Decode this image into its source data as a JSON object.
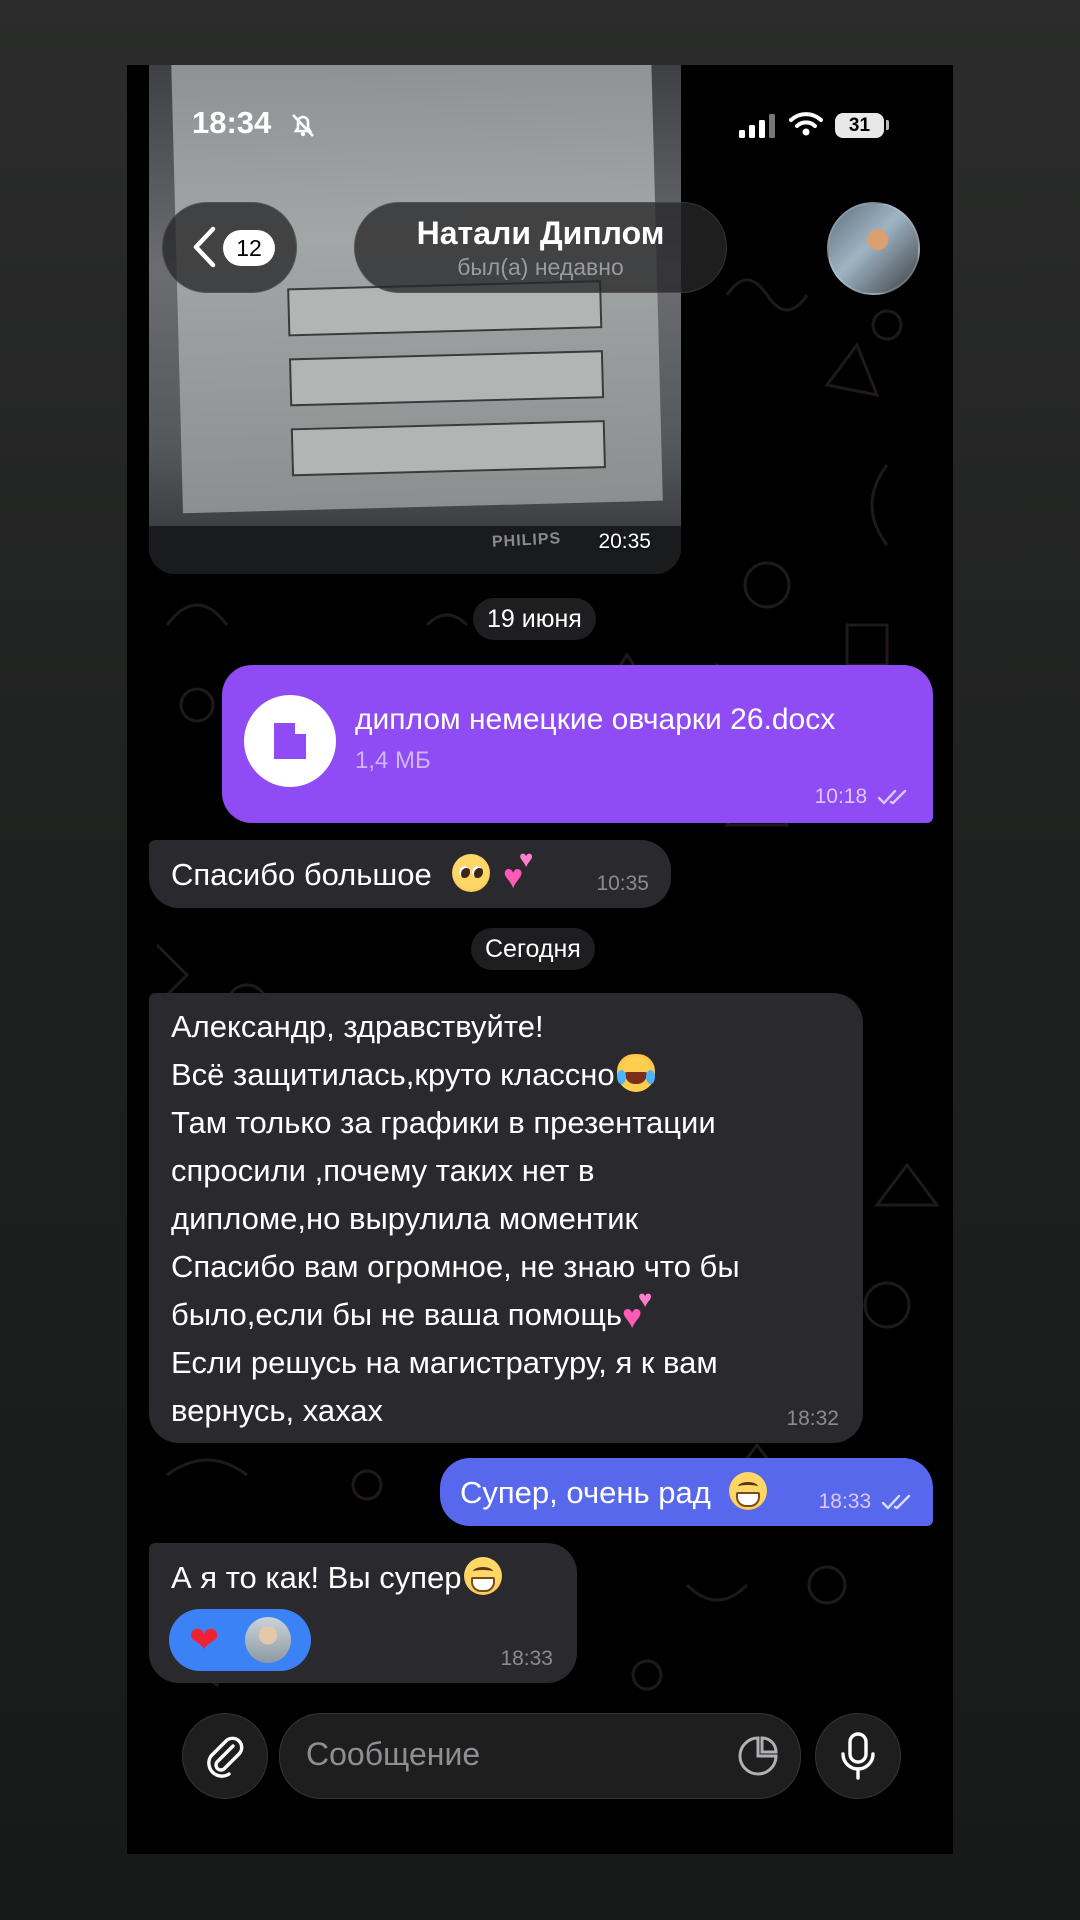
{
  "status_bar": {
    "time": "18:34",
    "battery": "31"
  },
  "header": {
    "back_count": "12",
    "title": "Натали Диплом",
    "subtitle": "был(а) недавно"
  },
  "photo_message": {
    "time": "20:35",
    "brand": "PHILIPS"
  },
  "dates": {
    "first": "19 июня",
    "second": "Сегодня"
  },
  "messages": {
    "file": {
      "name": "диплом немецкие овчарки 26.docx",
      "size": "1,4 МБ",
      "time": "10:18"
    },
    "thanks": {
      "text": "Спасибо большое",
      "time": "10:35"
    },
    "long": {
      "lines": [
        "Александр, здравствуйте!",
        "Всё защитилась,круто классно",
        "Там только за графики в презентации",
        "спросили ,почему таких нет в",
        "дипломе,но вырулила моментик",
        "Спасибо вам огромное, не знаю что бы",
        "было,если бы не ваша помощь",
        "Если решусь на магистратуру, я к вам",
        "вернусь, хахах"
      ],
      "time": "18:32"
    },
    "super": {
      "text": "Супер, очень рад",
      "time": "18:33"
    },
    "last": {
      "text": "А я то как! Вы супер",
      "time": "18:33",
      "reaction": "heart"
    }
  },
  "input": {
    "placeholder": "Сообщение"
  },
  "colors": {
    "outgoing_file": "#8f4cf5",
    "outgoing_text": "#5768ed",
    "incoming": "#2a2a2e",
    "reaction": "#3b82f6"
  },
  "icons": [
    "bell-slash-icon",
    "signal-icon",
    "wifi-icon",
    "battery-icon",
    "chevron-left-icon",
    "file-icon",
    "double-check-icon",
    "paperclip-icon",
    "sticker-icon",
    "microphone-icon"
  ]
}
